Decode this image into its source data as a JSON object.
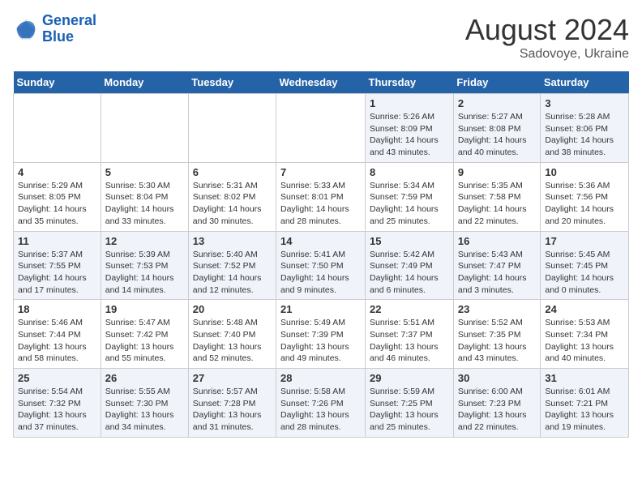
{
  "header": {
    "logo_general": "General",
    "logo_blue": "Blue",
    "month_year": "August 2024",
    "location": "Sadovoye, Ukraine"
  },
  "days_of_week": [
    "Sunday",
    "Monday",
    "Tuesday",
    "Wednesday",
    "Thursday",
    "Friday",
    "Saturday"
  ],
  "weeks": [
    [
      {
        "num": "",
        "info": ""
      },
      {
        "num": "",
        "info": ""
      },
      {
        "num": "",
        "info": ""
      },
      {
        "num": "",
        "info": ""
      },
      {
        "num": "1",
        "info": "Sunrise: 5:26 AM\nSunset: 8:09 PM\nDaylight: 14 hours and 43 minutes."
      },
      {
        "num": "2",
        "info": "Sunrise: 5:27 AM\nSunset: 8:08 PM\nDaylight: 14 hours and 40 minutes."
      },
      {
        "num": "3",
        "info": "Sunrise: 5:28 AM\nSunset: 8:06 PM\nDaylight: 14 hours and 38 minutes."
      }
    ],
    [
      {
        "num": "4",
        "info": "Sunrise: 5:29 AM\nSunset: 8:05 PM\nDaylight: 14 hours and 35 minutes."
      },
      {
        "num": "5",
        "info": "Sunrise: 5:30 AM\nSunset: 8:04 PM\nDaylight: 14 hours and 33 minutes."
      },
      {
        "num": "6",
        "info": "Sunrise: 5:31 AM\nSunset: 8:02 PM\nDaylight: 14 hours and 30 minutes."
      },
      {
        "num": "7",
        "info": "Sunrise: 5:33 AM\nSunset: 8:01 PM\nDaylight: 14 hours and 28 minutes."
      },
      {
        "num": "8",
        "info": "Sunrise: 5:34 AM\nSunset: 7:59 PM\nDaylight: 14 hours and 25 minutes."
      },
      {
        "num": "9",
        "info": "Sunrise: 5:35 AM\nSunset: 7:58 PM\nDaylight: 14 hours and 22 minutes."
      },
      {
        "num": "10",
        "info": "Sunrise: 5:36 AM\nSunset: 7:56 PM\nDaylight: 14 hours and 20 minutes."
      }
    ],
    [
      {
        "num": "11",
        "info": "Sunrise: 5:37 AM\nSunset: 7:55 PM\nDaylight: 14 hours and 17 minutes."
      },
      {
        "num": "12",
        "info": "Sunrise: 5:39 AM\nSunset: 7:53 PM\nDaylight: 14 hours and 14 minutes."
      },
      {
        "num": "13",
        "info": "Sunrise: 5:40 AM\nSunset: 7:52 PM\nDaylight: 14 hours and 12 minutes."
      },
      {
        "num": "14",
        "info": "Sunrise: 5:41 AM\nSunset: 7:50 PM\nDaylight: 14 hours and 9 minutes."
      },
      {
        "num": "15",
        "info": "Sunrise: 5:42 AM\nSunset: 7:49 PM\nDaylight: 14 hours and 6 minutes."
      },
      {
        "num": "16",
        "info": "Sunrise: 5:43 AM\nSunset: 7:47 PM\nDaylight: 14 hours and 3 minutes."
      },
      {
        "num": "17",
        "info": "Sunrise: 5:45 AM\nSunset: 7:45 PM\nDaylight: 14 hours and 0 minutes."
      }
    ],
    [
      {
        "num": "18",
        "info": "Sunrise: 5:46 AM\nSunset: 7:44 PM\nDaylight: 13 hours and 58 minutes."
      },
      {
        "num": "19",
        "info": "Sunrise: 5:47 AM\nSunset: 7:42 PM\nDaylight: 13 hours and 55 minutes."
      },
      {
        "num": "20",
        "info": "Sunrise: 5:48 AM\nSunset: 7:40 PM\nDaylight: 13 hours and 52 minutes."
      },
      {
        "num": "21",
        "info": "Sunrise: 5:49 AM\nSunset: 7:39 PM\nDaylight: 13 hours and 49 minutes."
      },
      {
        "num": "22",
        "info": "Sunrise: 5:51 AM\nSunset: 7:37 PM\nDaylight: 13 hours and 46 minutes."
      },
      {
        "num": "23",
        "info": "Sunrise: 5:52 AM\nSunset: 7:35 PM\nDaylight: 13 hours and 43 minutes."
      },
      {
        "num": "24",
        "info": "Sunrise: 5:53 AM\nSunset: 7:34 PM\nDaylight: 13 hours and 40 minutes."
      }
    ],
    [
      {
        "num": "25",
        "info": "Sunrise: 5:54 AM\nSunset: 7:32 PM\nDaylight: 13 hours and 37 minutes."
      },
      {
        "num": "26",
        "info": "Sunrise: 5:55 AM\nSunset: 7:30 PM\nDaylight: 13 hours and 34 minutes."
      },
      {
        "num": "27",
        "info": "Sunrise: 5:57 AM\nSunset: 7:28 PM\nDaylight: 13 hours and 31 minutes."
      },
      {
        "num": "28",
        "info": "Sunrise: 5:58 AM\nSunset: 7:26 PM\nDaylight: 13 hours and 28 minutes."
      },
      {
        "num": "29",
        "info": "Sunrise: 5:59 AM\nSunset: 7:25 PM\nDaylight: 13 hours and 25 minutes."
      },
      {
        "num": "30",
        "info": "Sunrise: 6:00 AM\nSunset: 7:23 PM\nDaylight: 13 hours and 22 minutes."
      },
      {
        "num": "31",
        "info": "Sunrise: 6:01 AM\nSunset: 7:21 PM\nDaylight: 13 hours and 19 minutes."
      }
    ]
  ]
}
